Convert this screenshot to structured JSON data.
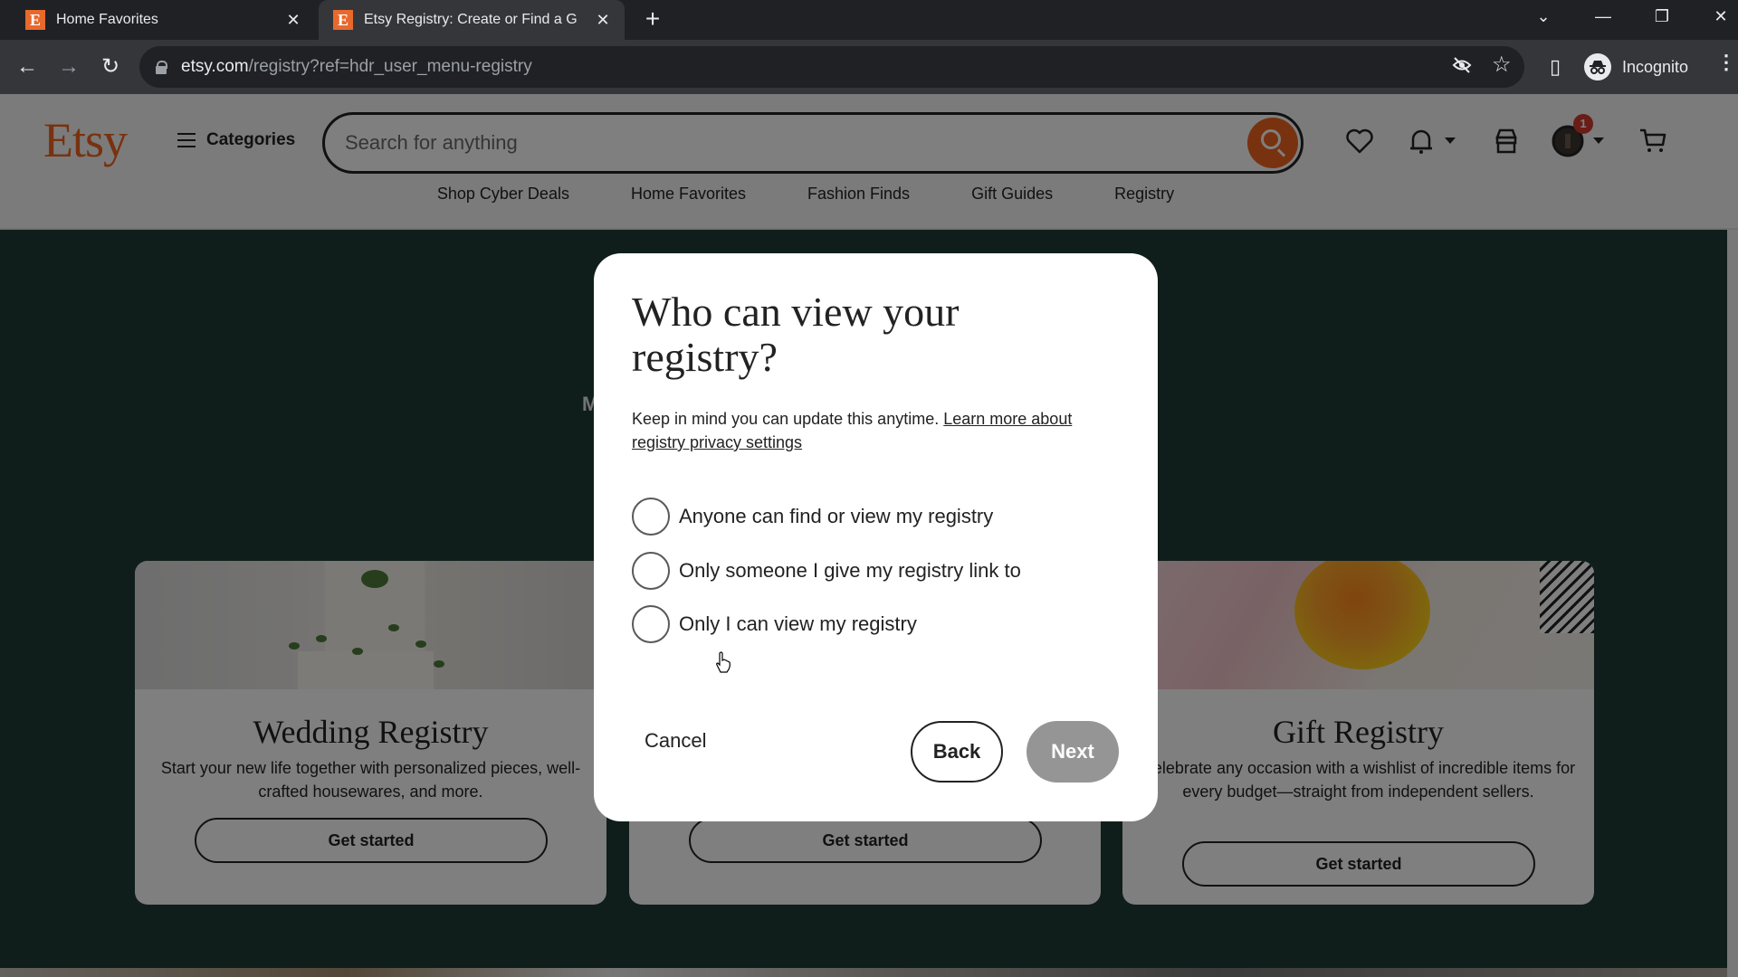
{
  "browser": {
    "tabs": [
      {
        "title": "Home Favorites",
        "favicon": "etsy-favicon",
        "active": false
      },
      {
        "title": "Etsy Registry: Create or Find a G",
        "favicon": "etsy-favicon",
        "active": true
      }
    ],
    "favicon_letter": "E",
    "url_host": "etsy.com",
    "url_path": "/registry?ref=hdr_user_menu-registry",
    "profile_label": "Incognito",
    "icons": {
      "back": "←",
      "forward": "→",
      "reload": "↻",
      "new_tab": "+",
      "close_tab": "✕",
      "tab_search": "⌄",
      "minimize": "—",
      "restore": "❐",
      "close_window": "✕",
      "eye_off": "eye-off-icon",
      "star": "☆",
      "side_panel": "▯",
      "menu": "⋮"
    }
  },
  "header": {
    "logo": "Etsy",
    "categories_label": "Categories",
    "search_placeholder": "Search for anything",
    "notification_badge": "1",
    "nav": [
      "Shop Cyber Deals",
      "Home Favorites",
      "Fashion Finds",
      "Gift Guides",
      "Registry"
    ]
  },
  "hero": {
    "partial_letter": "M"
  },
  "cards": [
    {
      "title": "Wedding Registry",
      "description": "Start your new life together with personalized pieces, well-crafted housewares, and more.",
      "button": "Get started"
    },
    {
      "title": "",
      "description": "",
      "button": "Get started"
    },
    {
      "title": "Gift Registry",
      "description": "Celebrate any occasion with a wishlist of incredible items for every budget—straight from independent sellers.",
      "button": "Get started"
    }
  ],
  "modal": {
    "title": "Who can view your registry?",
    "description": "Keep in mind you can update this anytime.",
    "link": "Learn more about registry privacy settings",
    "options": [
      {
        "label": "Anyone can find or view my registry",
        "checked": false
      },
      {
        "label": "Only someone I give my registry link to",
        "checked": false
      },
      {
        "label": "Only I can view my registry",
        "checked": false
      }
    ],
    "cancel_label": "Cancel",
    "back_label": "Back",
    "next_label": "Next",
    "next_enabled": false
  },
  "colors": {
    "brand_orange": "#f1641e",
    "hero_green": "#1f3d37",
    "next_disabled": "#959595",
    "badge_red": "#d33a2c"
  }
}
